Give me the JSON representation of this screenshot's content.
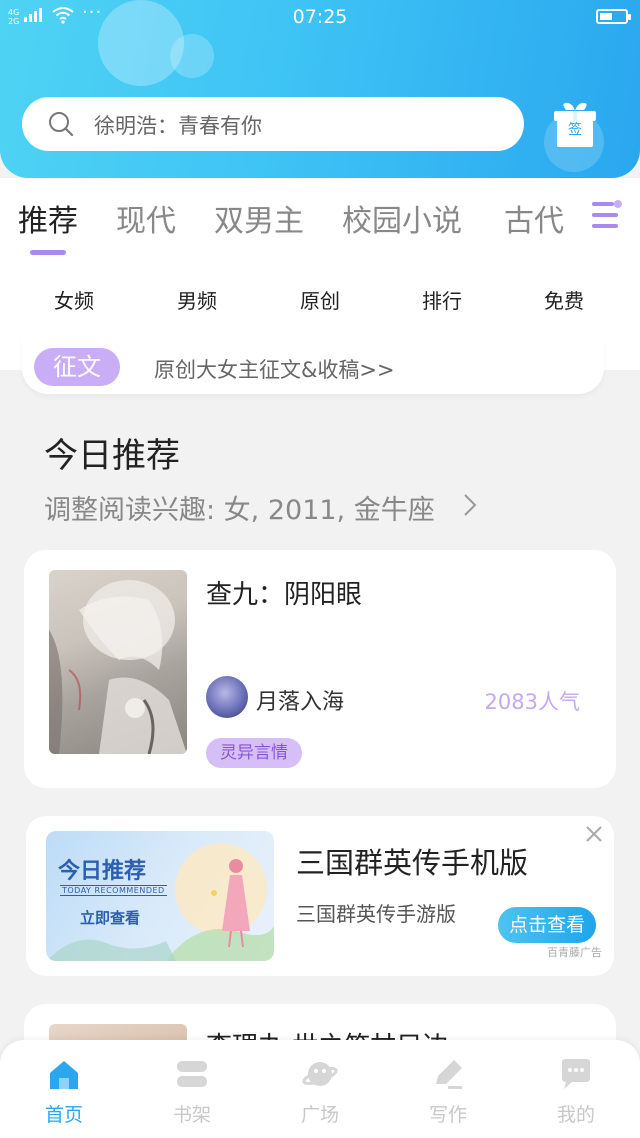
{
  "status_bar": {
    "network": "4G 2G",
    "more": "···",
    "time": "07:25"
  },
  "search": {
    "placeholder": "徐明浩：青春有你"
  },
  "gift": {
    "label": "签"
  },
  "tabs": [
    {
      "label": "推荐",
      "active": true
    },
    {
      "label": "现代",
      "active": false
    },
    {
      "label": "双男主",
      "active": false
    },
    {
      "label": "校园小说",
      "active": false
    },
    {
      "label": "古代",
      "active": false
    }
  ],
  "categories": [
    {
      "label": "女频"
    },
    {
      "label": "男频"
    },
    {
      "label": "原创"
    },
    {
      "label": "排行"
    },
    {
      "label": "免费"
    }
  ],
  "notice": {
    "badge": "征文",
    "text": "原创大女主征文&收稿>>"
  },
  "section": {
    "title": "今日推荐",
    "subtitle": "调整阅读兴趣: 女, 2011, 金牛座"
  },
  "book": {
    "title": "查九：阴阳眼",
    "author": "月落入海",
    "popularity": "2083人气",
    "tag": "灵异言情"
  },
  "ad": {
    "image_title": "今日推荐",
    "image_subtitle": "TODAY RECOMMENDED",
    "image_button": "立即查看",
    "title": "三国群英传手机版",
    "description": "三国群英传手游版",
    "button": "点击查看",
    "source": "百青藤广告"
  },
  "next_book": {
    "title": "李理办 世之笠甘只边"
  },
  "bottom_nav": [
    {
      "label": "首页",
      "icon": "home-icon",
      "active": true
    },
    {
      "label": "书架",
      "icon": "bookshelf-icon",
      "active": false
    },
    {
      "label": "广场",
      "icon": "planet-icon",
      "active": false
    },
    {
      "label": "写作",
      "icon": "pen-icon",
      "active": false
    },
    {
      "label": "我的",
      "icon": "chat-icon",
      "active": false
    }
  ],
  "colors": {
    "header_start": "#4fd3f4",
    "header_end": "#2aa7ef",
    "accent_purple": "#a98bf0",
    "tag_bg": "#d6bff7",
    "popularity": "#c6a7f2",
    "nav_active": "#2aa7ef"
  }
}
